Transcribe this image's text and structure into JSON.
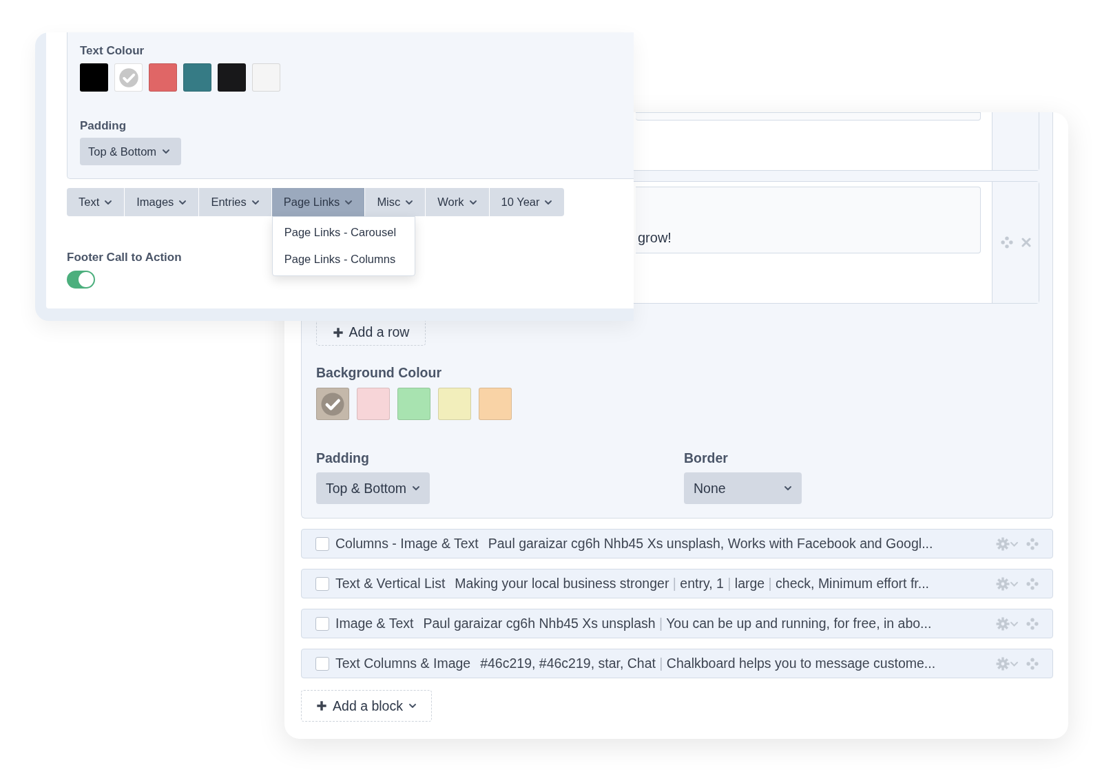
{
  "back_panel": {
    "rows": [
      {
        "field_text": ""
      },
      {
        "field_text": "grow!"
      }
    ],
    "add_row_button": "Add a row",
    "background_colour": {
      "label": "Background Colour",
      "swatches": [
        {
          "color": "#c4b8aa",
          "selected": true
        },
        {
          "color": "#f7d5d8",
          "selected": false
        },
        {
          "color": "#a8e3b0",
          "selected": false
        },
        {
          "color": "#f2eebb",
          "selected": false
        },
        {
          "color": "#f9d3a6",
          "selected": false
        }
      ]
    },
    "padding": {
      "label": "Padding",
      "value": "Top & Bottom"
    },
    "border": {
      "label": "Border",
      "value": "None"
    },
    "blocks": [
      {
        "checked": false,
        "title": "Columns - Image & Text",
        "summary": "Paul garaizar cg6h Nhb45 Xs unsplash, Works with Facebook and Googl..."
      },
      {
        "checked": false,
        "title": "Text & Vertical List",
        "summary": "Making your local business stronger | entry, 1 | large | check, Minimum effort fr..."
      },
      {
        "checked": false,
        "title": "Image & Text",
        "summary": "Paul garaizar cg6h Nhb45 Xs unsplash | You can be up and running, for free, in abo..."
      },
      {
        "checked": false,
        "title": "Text Columns & Image",
        "summary": "#46c219, #46c219, star, Chat | Chalkboard helps you to message custome..."
      }
    ],
    "add_block_button": "Add a block"
  },
  "front_panel": {
    "text_colour": {
      "label": "Text Colour",
      "swatches": [
        {
          "color": "#000000",
          "selected": false
        },
        {
          "color": "#ffffff",
          "selected": true
        },
        {
          "color": "#e06666",
          "selected": false
        },
        {
          "color": "#367b85",
          "selected": false
        },
        {
          "color": "#18181a",
          "selected": false
        },
        {
          "color": "#f5f5f5",
          "selected": false
        }
      ]
    },
    "padding": {
      "label": "Padding",
      "value": "Top & Bottom"
    },
    "tabs": [
      {
        "label": "Text",
        "selected": false
      },
      {
        "label": "Images",
        "selected": false
      },
      {
        "label": "Entries",
        "selected": false
      },
      {
        "label": "Page Links",
        "selected": true,
        "menu": [
          "Page Links - Carousel",
          "Page Links - Columns"
        ]
      },
      {
        "label": "Misc",
        "selected": false
      },
      {
        "label": "Work",
        "selected": false
      },
      {
        "label": "10 Year",
        "selected": false
      }
    ],
    "footer_cta": {
      "label": "Footer Call to Action",
      "on": true
    }
  }
}
